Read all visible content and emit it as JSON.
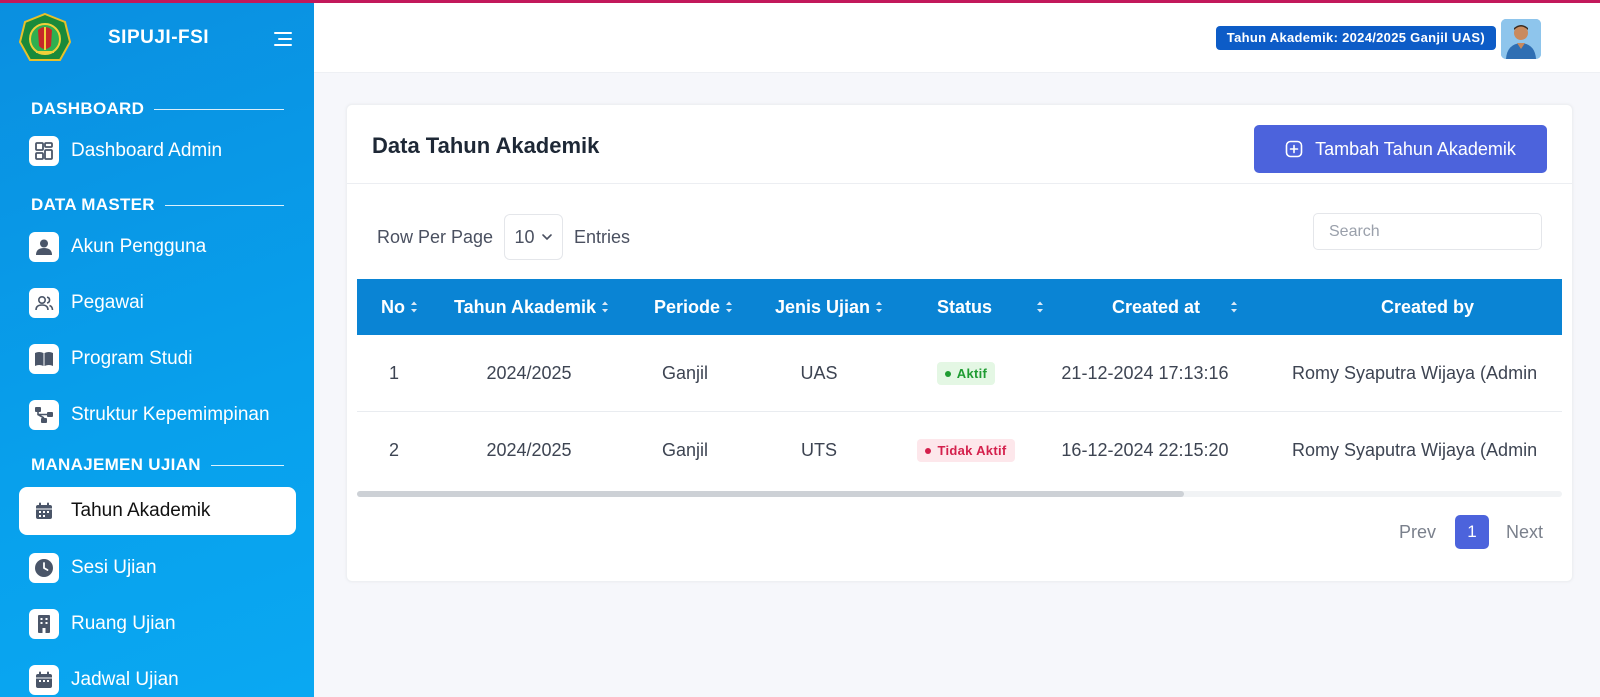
{
  "app": {
    "brand_title": "SIPUJI-FSI"
  },
  "sidebar": {
    "sections": [
      {
        "title": "DASHBOARD"
      },
      {
        "title": "DATA MASTER"
      },
      {
        "title": "MANAJEMEN UJIAN"
      }
    ],
    "items": [
      {
        "label": "Dashboard Admin",
        "icon": "dashboard-icon"
      },
      {
        "label": "Akun Pengguna",
        "icon": "user-icon"
      },
      {
        "label": "Pegawai",
        "icon": "users-icon"
      },
      {
        "label": "Program Studi",
        "icon": "book-icon"
      },
      {
        "label": "Struktur Kepemimpinan",
        "icon": "hierarchy-icon"
      },
      {
        "label": "Tahun Akademik",
        "icon": "calendar-icon",
        "active": true
      },
      {
        "label": "Sesi Ujian",
        "icon": "clock-icon"
      },
      {
        "label": "Ruang Ujian",
        "icon": "building-icon"
      },
      {
        "label": "Jadwal Ujian",
        "icon": "calendar-icon"
      }
    ]
  },
  "header": {
    "year_badge": "Tahun Akademik: 2024/2025 Ganjil UAS)"
  },
  "card": {
    "title": "Data Tahun Akademik",
    "add_button_label": "Tambah Tahun Akademik",
    "rows_per_page_label": "Row Per Page",
    "rows_per_page_value": "10",
    "entries_label": "Entries",
    "search_placeholder": "Search"
  },
  "table": {
    "columns": [
      "No",
      "Tahun Akademik",
      "Periode",
      "Jenis Ujian",
      "Status",
      "Created at",
      "Created by"
    ],
    "rows": [
      {
        "no": "1",
        "tahun": "2024/2025",
        "periode": "Ganjil",
        "jenis": "UAS",
        "status": "Aktif",
        "status_type": "active",
        "created_at": "21-12-2024 17:13:16",
        "created_by": "Romy Syaputra Wijaya (Admin"
      },
      {
        "no": "2",
        "tahun": "2024/2025",
        "periode": "Ganjil",
        "jenis": "UTS",
        "status": "Tidak Aktif",
        "status_type": "inactive",
        "created_at": "16-12-2024 22:15:20",
        "created_by": "Romy Syaputra Wijaya (Admin"
      }
    ]
  },
  "pagination": {
    "prev_label": "Prev",
    "current_page": "1",
    "next_label": "Next"
  },
  "colors": {
    "sidebar": "#0a9ae6",
    "primary_button": "#4c63dc",
    "table_header": "#0a84d4",
    "badge_blue": "#0d5cc7",
    "active_green": "#1f9c32",
    "inactive_red": "#d4204c"
  }
}
